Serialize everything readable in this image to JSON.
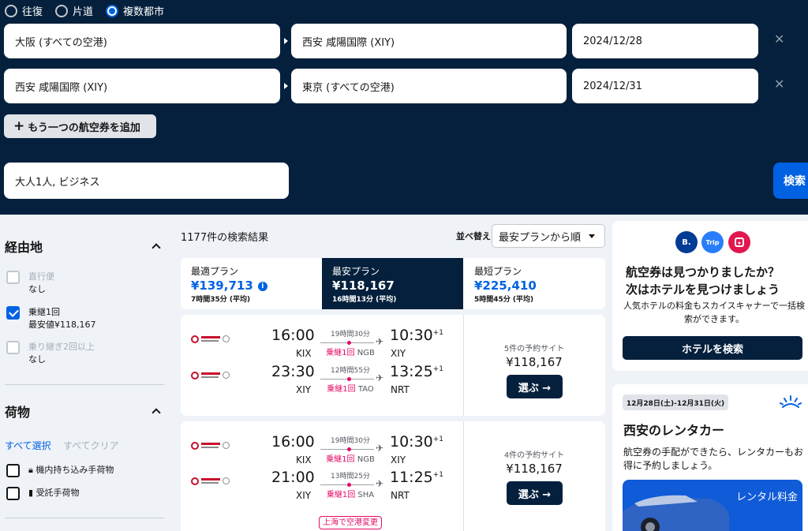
{
  "trip_type": {
    "options": [
      "往復",
      "片道",
      "複数都市"
    ],
    "selected": "複数都市"
  },
  "legs": [
    {
      "from": "大阪 (すべての空港)",
      "to": "西安 咸陽国際 (XIY)",
      "date": "2024/12/28"
    },
    {
      "from": "西安 咸陽国際 (XIY)",
      "to": "東京 (すべての空港)",
      "date": "2024/12/31"
    }
  ],
  "add_flight_label": "もう一つの航空券を追加",
  "travellers": "大人1人, ビジネス",
  "search_label": "検索",
  "filters": {
    "stops": {
      "title": "経由地",
      "options": [
        {
          "label": "直行便",
          "sub": "なし",
          "checked": false,
          "disabled": true
        },
        {
          "label": "乗継1回",
          "sub": "最安値¥118,167",
          "checked": true,
          "disabled": false
        },
        {
          "label": "乗り継ぎ2回以上",
          "sub": "なし",
          "checked": false,
          "disabled": true
        }
      ]
    },
    "baggage": {
      "title": "荷物",
      "select_all": "すべて選択",
      "clear_all": "すべてクリア",
      "options": [
        {
          "label": "機内持ち込み手荷物",
          "checked": false
        },
        {
          "label": "受託手荷物",
          "checked": false
        }
      ]
    }
  },
  "results": {
    "count": "1177件の検索結果",
    "sort_label": "並べ替え",
    "sort_value": "最安プランから順",
    "tabs": [
      {
        "label": "最適プラン",
        "price": "¥139,713",
        "sub": "7時間35分 (平均)",
        "active": false,
        "info": "i"
      },
      {
        "label": "最安プラン",
        "price": "¥118,167",
        "sub": "16時間13分 (平均)",
        "active": true
      },
      {
        "label": "最短プラン",
        "price": "¥225,410",
        "sub": "5時間45分 (平均)",
        "active": false
      }
    ],
    "cards": [
      {
        "legs": [
          {
            "dep": "16:00",
            "dep_ap": "KIX",
            "duration": "19時間30分",
            "stops": "乗継1回",
            "via": "NGB",
            "arr": "10:30",
            "arr_ap": "XIY",
            "plus": "+1"
          },
          {
            "dep": "23:30",
            "dep_ap": "XIY",
            "duration": "12時間55分",
            "stops": "乗継1回",
            "via": "TAO",
            "arr": "13:25",
            "arr_ap": "NRT",
            "plus": "+1"
          }
        ],
        "sites": "5件の予約サイト",
        "price": "¥118,167",
        "select": "選ぶ →"
      },
      {
        "legs": [
          {
            "dep": "16:00",
            "dep_ap": "KIX",
            "duration": "19時間30分",
            "stops": "乗継1回",
            "via": "NGB",
            "arr": "10:30",
            "arr_ap": "XIY",
            "plus": "+1"
          },
          {
            "dep": "21:00",
            "dep_ap": "XIY",
            "duration": "13時間25分",
            "stops": "乗継1回",
            "via": "SHA",
            "arr": "11:25",
            "arr_ap": "NRT",
            "plus": "+1"
          }
        ],
        "sites": "4件の予約サイト",
        "price": "¥118,167",
        "select": "選ぶ →",
        "warning": "上海で空港変更"
      }
    ]
  },
  "hotel_ad": {
    "badges": [
      {
        "text": "B.",
        "color": "#003b95"
      },
      {
        "text": "Trip",
        "color": "#287dfa"
      },
      {
        "text": "",
        "color": "#e2174f"
      }
    ],
    "title1": "航空券は見つかりましたか？",
    "title2": "次はホテルを見つけましょう",
    "text": "人気ホテルの料金もスカイスキャナーで一括検索ができます。",
    "button": "ホテルを検索"
  },
  "car_ad": {
    "dates": "12月28日(土)-12月31日(火)",
    "title": "西安のレンタカー",
    "text": "航空券の手配ができたら、レンタカーもお得に予約しましょう。",
    "image_label": "レンタル料金"
  },
  "colors": {
    "header_bg": "#05203c",
    "accent": "#0062e3",
    "stop_red": "#e70866"
  }
}
